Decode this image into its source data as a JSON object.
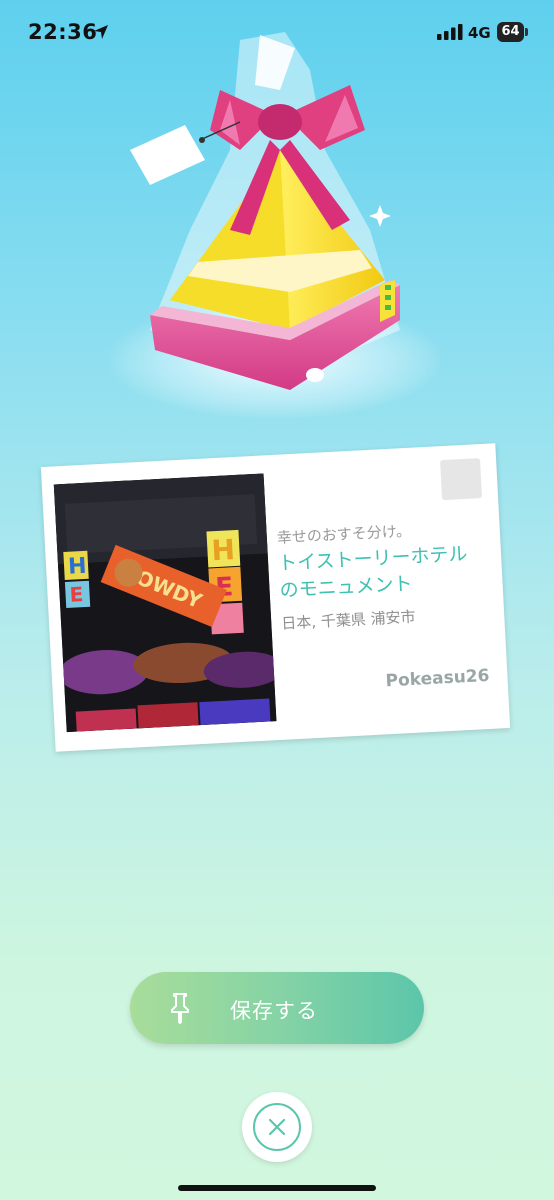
{
  "status_bar": {
    "time": "22:36",
    "network": "4G",
    "battery": "64"
  },
  "gift": {
    "icon": "gift-box-icon",
    "colors": {
      "ribbon": "#e0407f",
      "body": "#f7e23a",
      "base": "#e04a92"
    }
  },
  "postcard": {
    "subtitle": "幸せのおすそ分け。",
    "title": "トイストーリーホテルのモニュメント",
    "location": "日本, 千葉県 浦安市",
    "sender": "Pokeasu26",
    "photo": {
      "letters": [
        "H",
        "E",
        "H",
        "E",
        "HOWDY"
      ]
    }
  },
  "actions": {
    "save_label": "保存する",
    "save_icon": "pin-icon",
    "close_icon": "close-icon"
  },
  "colors": {
    "accent": "#5cc6aa",
    "title_text": "#3fc1b2"
  }
}
